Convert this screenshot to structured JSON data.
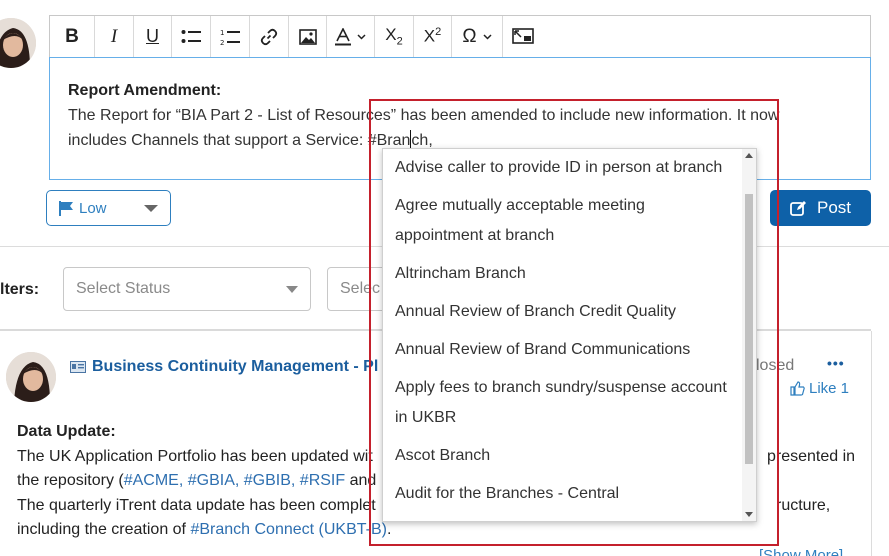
{
  "editor": {
    "toolbar": {
      "bold": "B",
      "italic": "I",
      "underline": "U",
      "subscript_base": "X",
      "subscript_sub": "2",
      "superscript_base": "X",
      "superscript_sup": "2",
      "special_char": "Ω"
    },
    "content": {
      "heading": "Report Amendment:",
      "line1": "The Report for “BIA Part 2 - List of Resources” has been amended to include new information. It now",
      "line2_before_caret": "includes Channels that support a Service: #Bran",
      "line2_after_caret": "ch,"
    }
  },
  "priority": {
    "label": "Low"
  },
  "post_button": {
    "label": "Post"
  },
  "filters": {
    "label": "lters:",
    "status_placeholder": "Select Status",
    "second_placeholder": "Selec"
  },
  "post": {
    "title": "Business Continuity Management - Pl",
    "status": "losed",
    "more": "•••",
    "like_label": "Like 1",
    "heading": "Data Update:",
    "line1": "The UK Application Portfolio has been updated wit",
    "line1_right": "presented in",
    "line2_before": "the repository (",
    "tag_acme": "#ACME",
    "tag_gbia": "#GBIA",
    "tag_gbib": "#GBIB",
    "tag_rsif": "#RSIF",
    "line2_after": " and",
    "line3": "The quarterly iTrent data update has been complet",
    "line3_right": "ructure,",
    "line4_before": "including the creation of ",
    "tag_branch_connect": "#Branch Connect (UKBT-B)",
    "line4_after": ".",
    "show_more": "[Show More]"
  },
  "autocomplete": {
    "items": [
      "Advise caller to provide ID in person at branch",
      "Agree mutually acceptable meeting appointment at branch",
      "Altrincham Branch",
      "Annual Review of Branch Credit Quality",
      "Annual Review of Brand Communications",
      "Apply fees to branch sundry/suspense account in UKBR",
      "Ascot Branch",
      "Audit for the Branches - Central"
    ]
  },
  "colors": {
    "accent": "#0e61a8",
    "link": "#2e6fb0",
    "highlight": "#c4202c"
  }
}
